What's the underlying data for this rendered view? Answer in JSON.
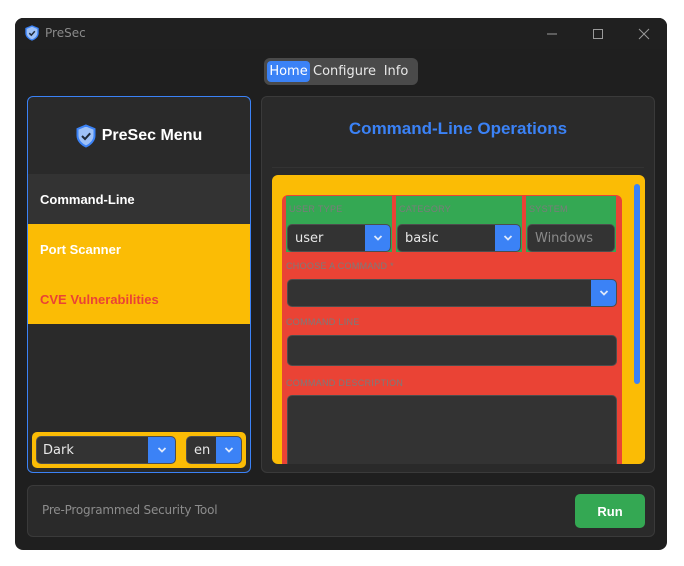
{
  "window": {
    "title": "PreSec",
    "controls": [
      "minimize",
      "maximize",
      "close"
    ]
  },
  "top_nav": {
    "tabs": [
      {
        "label": "Home",
        "active": true
      },
      {
        "label": "Configure",
        "active": false
      },
      {
        "label": "Info",
        "active": false
      }
    ]
  },
  "sidebar": {
    "title": "PreSec Menu",
    "logo_icon": "shield-check-icon",
    "items": [
      {
        "label": "Command-Line",
        "active": true
      },
      {
        "label": "Port Scanner",
        "active": false
      },
      {
        "label": "CVE Vulnerabilities",
        "active": false
      }
    ],
    "theme_select": {
      "value": "Dark"
    },
    "language_select": {
      "value": "en"
    }
  },
  "main": {
    "title": "Command-Line Operations",
    "fields": {
      "user_type": {
        "label": "USER TYPE",
        "value": "user"
      },
      "category": {
        "label": "CATEGORY",
        "value": "basic"
      },
      "system": {
        "label": "SYSTEM",
        "placeholder": "Windows"
      },
      "choose_command": {
        "label": "CHOOSE A COMMAND *",
        "value": ""
      },
      "command_line": {
        "label": "COMMAND LINE",
        "value": ""
      },
      "command_description": {
        "label": "COMMAND DESCRIPTION",
        "value": ""
      }
    }
  },
  "footer": {
    "status_text": "Pre-Programmed Security Tool",
    "run_label": "Run"
  },
  "colors": {
    "accent": "#3b82f6",
    "yellow": "#fbbc05",
    "red": "#ea4335",
    "green": "#34a853",
    "background": "#1f1f1f",
    "panel": "#2a2a2a"
  }
}
